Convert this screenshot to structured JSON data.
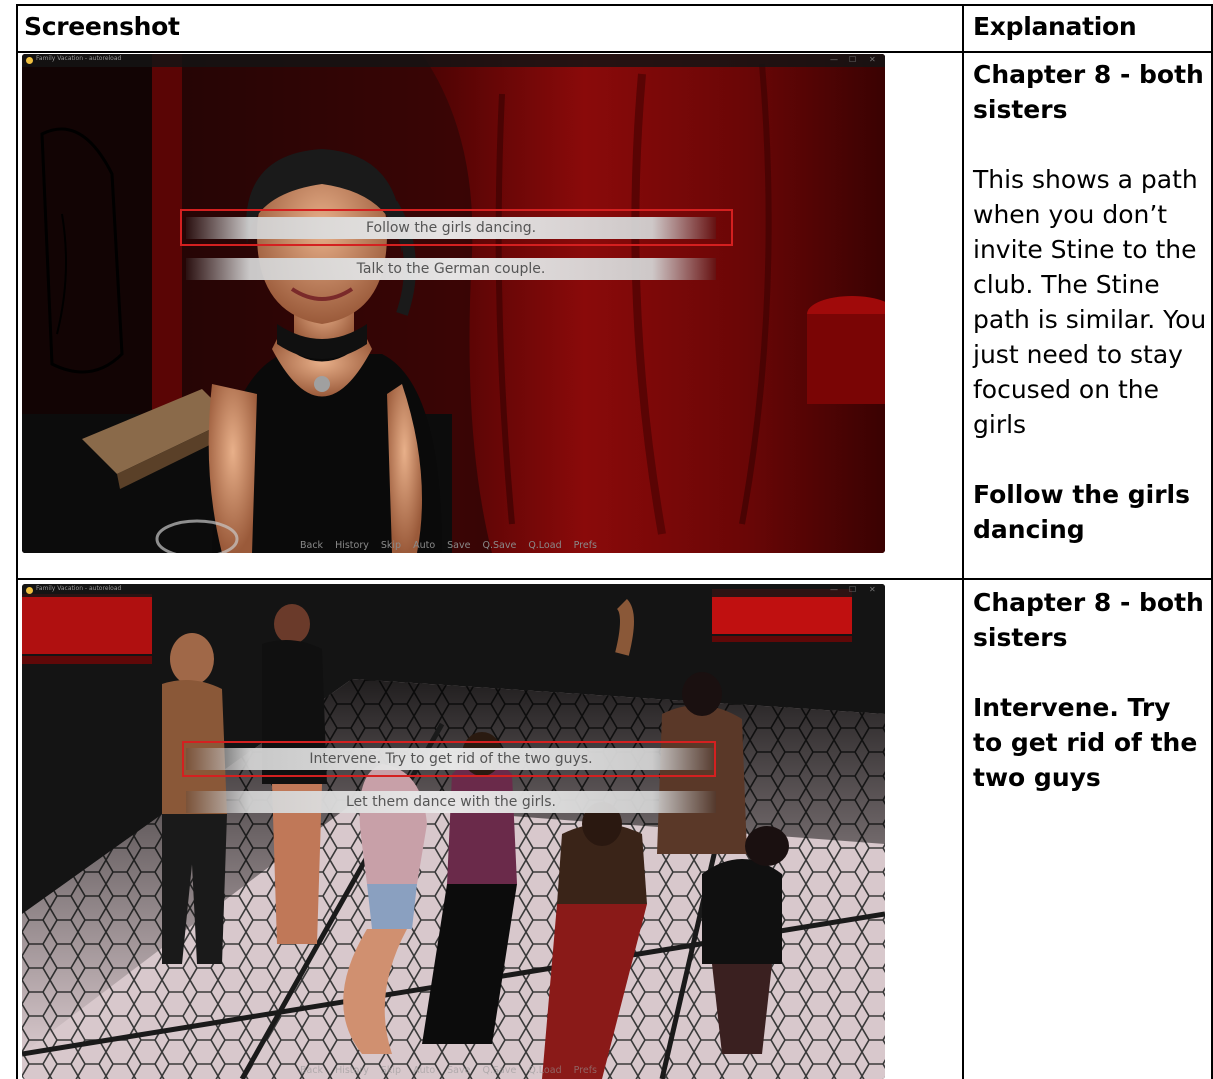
{
  "table": {
    "header_screenshot": "Screenshot",
    "header_explanation": "Explanation"
  },
  "rows": [
    {
      "window_title": "Family Vacation - autoreload",
      "choices": [
        "Follow the girls dancing.",
        "Talk to the German couple."
      ],
      "quick_menu": [
        "Back",
        "History",
        "Skip",
        "Auto",
        "Save",
        "Q.Save",
        "Q.Load",
        "Prefs"
      ],
      "chapter": "Chapter 8 - both sisters",
      "description": "This shows a path when you don’t invite Stine to the club. The Stine path is similar. You just need to stay focused on the girls",
      "choice_label": "Follow the girls dancing"
    },
    {
      "window_title": "Family Vacation - autoreload",
      "choices": [
        "Intervene. Try to get rid of the two guys.",
        "Let them dance with the girls."
      ],
      "quick_menu": [
        "Back",
        "History",
        "Skip",
        "Auto",
        "Save",
        "Q.Save",
        "Q.Load",
        "Prefs"
      ],
      "chapter": "Chapter 8 - both sisters",
      "choice_label": "Intervene. Try to get rid of the two guys"
    }
  ],
  "colors": {
    "highlight": "#d42020",
    "club_red": "#7a0a0a"
  },
  "window_controls": [
    "—",
    "☐",
    "✕"
  ]
}
